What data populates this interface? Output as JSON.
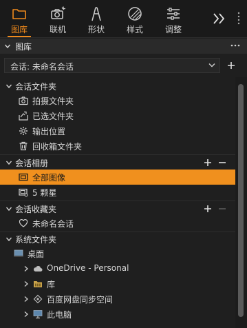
{
  "toolbar": {
    "tabs": [
      {
        "label": "图库",
        "icon": "folder-icon",
        "active": true
      },
      {
        "label": "联机",
        "icon": "tethered-camera-icon",
        "active": false
      },
      {
        "label": "形状",
        "icon": "shape-icon",
        "active": false
      },
      {
        "label": "样式",
        "icon": "styles-icon",
        "active": false
      },
      {
        "label": "调整",
        "icon": "sliders-icon",
        "active": false
      }
    ],
    "more_icon": "double-chevron-right-icon",
    "accent": "#f08a1c"
  },
  "panel": {
    "title": "图库",
    "menu_icon": "more-dots-icon"
  },
  "session": {
    "selected": "会话: 未命名会话",
    "add_icon": "plus-icon"
  },
  "sections": {
    "folders": {
      "title": "会话文件夹",
      "items": [
        "拍摄文件夹",
        "已选文件夹",
        "输出位置",
        "回收箱文件夹"
      ]
    },
    "albums": {
      "title": "会话相册",
      "items": [
        "全部图像",
        "5 颗星"
      ]
    },
    "favorites": {
      "title": "会话收藏夹",
      "items": [
        "未命名会话"
      ]
    },
    "system": {
      "title": "系统文件夹",
      "root": "桌面",
      "children": [
        "OneDrive - Personal",
        "库",
        "百度网盘同步空间",
        "此电脑"
      ]
    }
  },
  "selected_color": "#f0901e"
}
